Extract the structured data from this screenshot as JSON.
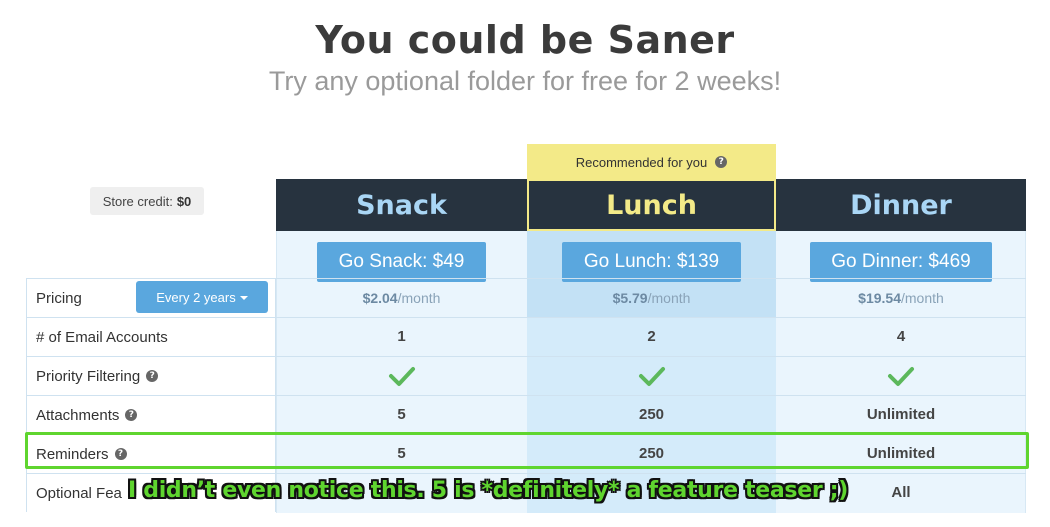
{
  "header": {
    "title": "You could be Saner",
    "subtitle": "Try any optional folder for free for 2 weeks!"
  },
  "recommended": {
    "label": "Recommended for you",
    "help_icon": "question-circle-icon"
  },
  "store_credit": {
    "label": "Store credit:",
    "value": "$0"
  },
  "plans": [
    {
      "name": "Snack",
      "button": "Go Snack: $49",
      "monthly_price": "$2.04",
      "monthly_suffix": "/month"
    },
    {
      "name": "Lunch",
      "button": "Go Lunch: $139",
      "monthly_price": "$5.79",
      "monthly_suffix": "/month"
    },
    {
      "name": "Dinner",
      "button": "Go Dinner: $469",
      "monthly_price": "$19.54",
      "monthly_suffix": "/month"
    }
  ],
  "pricing": {
    "label": "Pricing",
    "period_select": "Every 2 years"
  },
  "features": [
    {
      "label": "# of Email Accounts",
      "help": false,
      "values": [
        "1",
        "2",
        "4"
      ]
    },
    {
      "label": "Priority Filtering",
      "help": true,
      "values": [
        "check",
        "check",
        "check"
      ]
    },
    {
      "label": "Attachments",
      "help": true,
      "values": [
        "5",
        "250",
        "Unlimited"
      ]
    },
    {
      "label": "Reminders",
      "help": true,
      "values": [
        "5",
        "250",
        "Unlimited"
      ]
    },
    {
      "label": "Optional Fea",
      "help": false,
      "values": [
        "",
        "",
        "All"
      ]
    }
  ],
  "annotation": {
    "text": "I didn’t even notice this. 5 is *definitely* a feature teaser ;)",
    "color": "#5fd52f"
  },
  "colors": {
    "header_bg": "#27333f",
    "plan_name": "#a9d6f5",
    "recommended": "#f3ea88",
    "button": "#5aa7de",
    "check": "#5cb85c"
  }
}
